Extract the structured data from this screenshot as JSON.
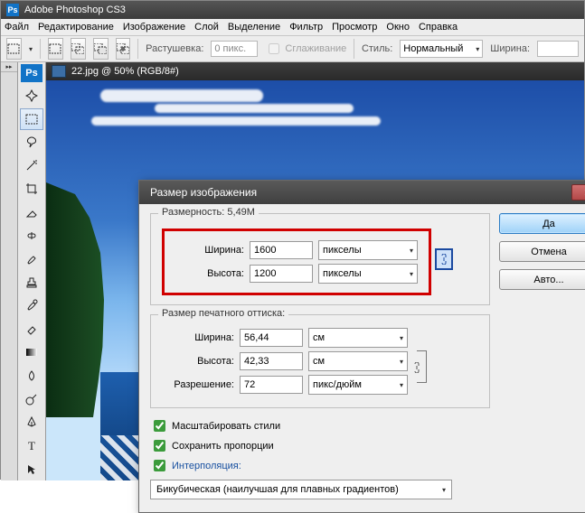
{
  "titlebar": {
    "app_name": "Adobe Photoshop CS3"
  },
  "menubar": {
    "items": [
      "Файл",
      "Редактирование",
      "Изображение",
      "Слой",
      "Выделение",
      "Фильтр",
      "Просмотр",
      "Окно",
      "Справка"
    ]
  },
  "options_bar": {
    "feather_label": "Растушевка:",
    "feather_value": "0 пикс.",
    "antialias_label": "Сглаживание",
    "style_label": "Стиль:",
    "style_value": "Нормальный",
    "width_label": "Ширина:"
  },
  "document_tab": {
    "title": "22.jpg @ 50% (RGB/8#)"
  },
  "dialog": {
    "title": "Размер изображения",
    "buttons": {
      "ok": "Да",
      "cancel": "Отмена",
      "auto": "Авто..."
    },
    "pixel_dims": {
      "group_label": "Размерность:",
      "filesize": "5,49M",
      "width_label": "Ширина:",
      "width_value": "1600",
      "height_label": "Высота:",
      "height_value": "1200",
      "unit": "пикселы"
    },
    "print_dims": {
      "group_label": "Размер печатного оттиска:",
      "width_label": "Ширина:",
      "width_value": "56,44",
      "height_label": "Высота:",
      "height_value": "42,33",
      "unit": "см",
      "res_label": "Разрешение:",
      "res_value": "72",
      "res_unit": "пикс/дюйм"
    },
    "checks": {
      "scale_styles": "Масштабировать стили",
      "constrain": "Сохранить пропорции",
      "resample": "Интерполяция:"
    },
    "interpolation": "Бикубическая (наилучшая для плавных градиентов)"
  }
}
